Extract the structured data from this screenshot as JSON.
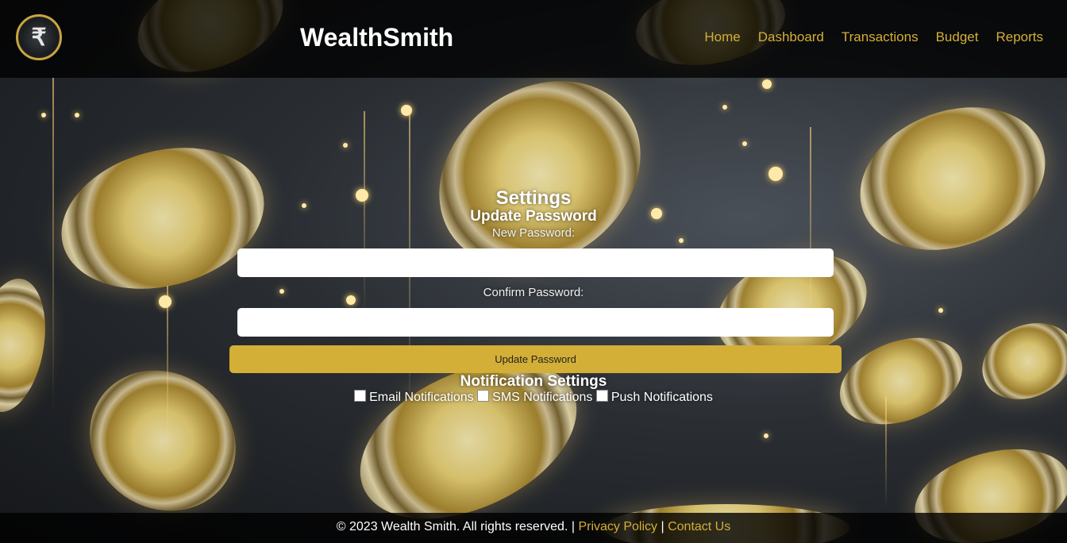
{
  "header": {
    "logo_symbol": "₹",
    "brand": "WealthSmith",
    "nav": [
      "Home",
      "Dashboard",
      "Transactions",
      "Budget",
      "Reports"
    ]
  },
  "settings": {
    "title": "Settings",
    "update_password": {
      "heading": "Update Password",
      "new_label": "New Password:",
      "new_value": "",
      "confirm_label": "Confirm Password:",
      "confirm_value": "",
      "button": "Update Password"
    },
    "notifications": {
      "heading": "Notification Settings",
      "options": [
        "Email Notifications",
        "SMS Notifications",
        "Push Notifications"
      ]
    }
  },
  "footer": {
    "copyright": "© 2023 Wealth Smith. All rights reserved.",
    "sep1": "|",
    "privacy": "Privacy Policy",
    "sep2": "|",
    "contact": "Contact Us"
  },
  "colors": {
    "accent": "#d4af37",
    "header_bg": "#000000"
  }
}
